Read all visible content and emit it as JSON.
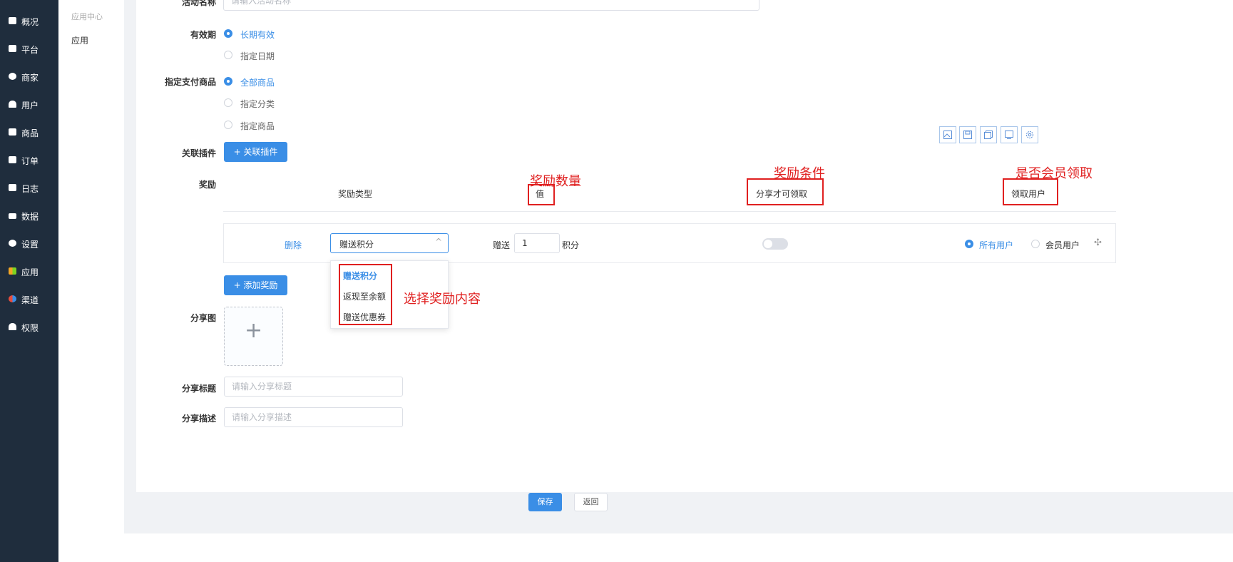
{
  "sidebar": {
    "items": [
      {
        "label": "概况",
        "icon": "monitor-icon"
      },
      {
        "label": "平台",
        "icon": "platform-icon"
      },
      {
        "label": "商家",
        "icon": "shop-icon"
      },
      {
        "label": "用户",
        "icon": "user-icon"
      },
      {
        "label": "商品",
        "icon": "goods-icon"
      },
      {
        "label": "订单",
        "icon": "order-icon"
      },
      {
        "label": "日志",
        "icon": "log-icon"
      },
      {
        "label": "数据",
        "icon": "chart-icon"
      },
      {
        "label": "设置",
        "icon": "gear-icon"
      },
      {
        "label": "应用",
        "icon": "apps-icon"
      },
      {
        "label": "渠道",
        "icon": "channel-icon"
      },
      {
        "label": "权限",
        "icon": "lock-icon"
      }
    ]
  },
  "subnav": {
    "section": "应用中心",
    "item": "应用"
  },
  "form": {
    "activity_name_label": "活动名称",
    "activity_name_placeholder": "请输入活动名称",
    "validity_label": "有效期",
    "validity_options": [
      "长期有效",
      "指定日期"
    ],
    "goods_label": "指定支付商品",
    "goods_options": [
      "全部商品",
      "指定分类",
      "指定商品"
    ],
    "plugin_label": "关联插件",
    "plugin_button": "+ 关联插件",
    "reward_label": "奖励",
    "reward_headers": {
      "type": "奖励类型",
      "value": "值",
      "condition": "分享才可领取",
      "user": "领取用户"
    },
    "reward_row": {
      "delete": "删除",
      "type_selected": "赠送积分",
      "give_label": "赠送",
      "give_value": "1",
      "unit": "积分",
      "user_options": [
        "所有用户",
        "会员用户"
      ]
    },
    "type_options": [
      "赠送积分",
      "返现至余额",
      "赠送优惠券"
    ],
    "add_reward_button": "+ 添加奖励",
    "share_image_label": "分享图",
    "share_title_label": "分享标题",
    "share_title_placeholder": "请输入分享标题",
    "share_desc_label": "分享描述",
    "share_desc_placeholder": "请输入分享描述"
  },
  "annotations": {
    "value": "奖励数量",
    "condition": "奖励条件",
    "member": "是否会员领取",
    "select": "选择奖励内容"
  },
  "footer": {
    "save": "保存",
    "back": "返回"
  },
  "colors": {
    "primary": "#3a8ee6",
    "sidebar": "#1f2d3d",
    "annotation": "#e02020"
  }
}
